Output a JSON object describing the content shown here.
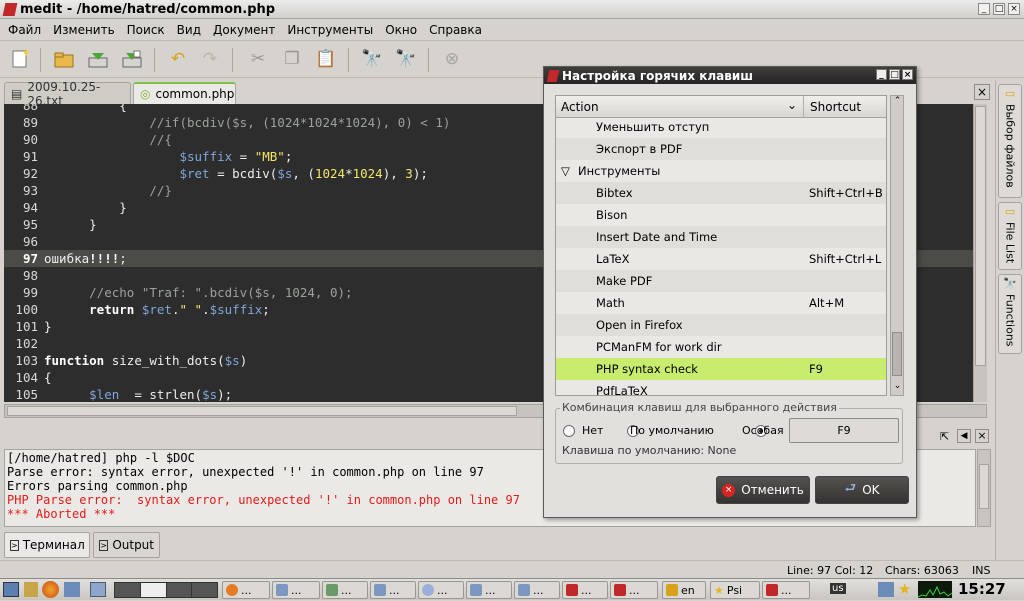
{
  "window": {
    "title": "medit - /home/hatred/common.php",
    "controls": [
      "_",
      "□",
      "×"
    ]
  },
  "menu": [
    "Файл",
    "Изменить",
    "Поиск",
    "Вид",
    "Документ",
    "Инструменты",
    "Окно",
    "Справка"
  ],
  "tabs": [
    {
      "label": "2009.10.25-26.txt"
    },
    {
      "label": "common.php",
      "active": true
    }
  ],
  "editor": {
    "current_line": 97,
    "lines": [
      {
        "n": "88",
        "t": "          {"
      },
      {
        "n": "89",
        "t": "              //if(bcdiv($s, (1024*1024*1024), 0) < 1)"
      },
      {
        "n": "90",
        "t": "              //{"
      },
      {
        "n": "91",
        "t": "                  $suffix = \"MB\";"
      },
      {
        "n": "92",
        "t": "                  $ret = bcdiv($s, (1024*1024), 3);"
      },
      {
        "n": "93",
        "t": "              //}"
      },
      {
        "n": "94",
        "t": "          }"
      },
      {
        "n": "95",
        "t": "      }"
      },
      {
        "n": "96",
        "t": ""
      },
      {
        "n": "97",
        "t": "ошибка!!!!;"
      },
      {
        "n": "98",
        "t": ""
      },
      {
        "n": "99",
        "t": "      //echo \"Traf: \".bcdiv($s, 1024, 0);"
      },
      {
        "n": "100",
        "t": "      return $ret.\" \".$suffix;"
      },
      {
        "n": "101",
        "t": "}"
      },
      {
        "n": "102",
        "t": ""
      },
      {
        "n": "103",
        "t": "function size_with_dots($s)"
      },
      {
        "n": "104",
        "t": "{"
      },
      {
        "n": "105",
        "t": "      $len  = strlen($s);"
      }
    ]
  },
  "output": {
    "lines": [
      {
        "t": "[/home/hatred] php -l $DOC",
        "error": false
      },
      {
        "t": "Parse error: syntax error, unexpected '!' in common.php on line 97",
        "error": false
      },
      {
        "t": "Errors parsing common.php",
        "error": false
      },
      {
        "t": "PHP Parse error:  syntax error, unexpected '!' in common.php on line 97",
        "error": true
      },
      {
        "t": "*** Aborted ***",
        "error": true
      }
    ]
  },
  "bottom_tabs": [
    "Терминал",
    "Output"
  ],
  "right_dock": [
    "Выбор файлов",
    "File List",
    "Functions"
  ],
  "status": {
    "position": "Line: 97 Col: 12",
    "chars": "Chars: 63063",
    "mode": "INS"
  },
  "taskbar": {
    "clock": "15:27",
    "lang": "en",
    "psi": "Psi",
    "kbd": "us"
  },
  "dialog": {
    "title": "Настройка горячих клавиш",
    "columns": {
      "action": "Action",
      "shortcut": "Shortcut"
    },
    "rows": [
      {
        "action": "Уменьшить отступ",
        "shortcut": "",
        "level": 1
      },
      {
        "action": "Экспорт в PDF",
        "shortcut": "",
        "level": 1
      },
      {
        "action": "Инструменты",
        "shortcut": "",
        "level": 0,
        "expanded": true
      },
      {
        "action": "Bibtex",
        "shortcut": "Shift+Ctrl+B",
        "level": 1
      },
      {
        "action": "Bison",
        "shortcut": "",
        "level": 1
      },
      {
        "action": "Insert Date and Time",
        "shortcut": "",
        "level": 1
      },
      {
        "action": "LaTeX",
        "shortcut": "Shift+Ctrl+L",
        "level": 1
      },
      {
        "action": "Make PDF",
        "shortcut": "",
        "level": 1
      },
      {
        "action": "Math",
        "shortcut": "Alt+M",
        "level": 1
      },
      {
        "action": "Open in Firefox",
        "shortcut": "",
        "level": 1
      },
      {
        "action": "PCManFM for work dir",
        "shortcut": "",
        "level": 1
      },
      {
        "action": "PHP syntax check",
        "shortcut": "F9",
        "level": 1,
        "selected": true
      },
      {
        "action": "PdfLaTeX",
        "shortcut": "",
        "level": 1
      }
    ],
    "frame_title": "Комбинация клавиш для выбранного действия",
    "radio_none": "Нет",
    "radio_default": "По умолчанию",
    "radio_custom": "Особая",
    "radio_selected": "custom",
    "shortcut_value": "F9",
    "default_key_label": "Клавиша по умолчанию: None",
    "cancel": "Отменить",
    "ok": "OK",
    "colors": {
      "selected_row": "#c7ec6e",
      "error_text": "#e41a1a",
      "editor_bg": "#2d2d2d"
    }
  }
}
